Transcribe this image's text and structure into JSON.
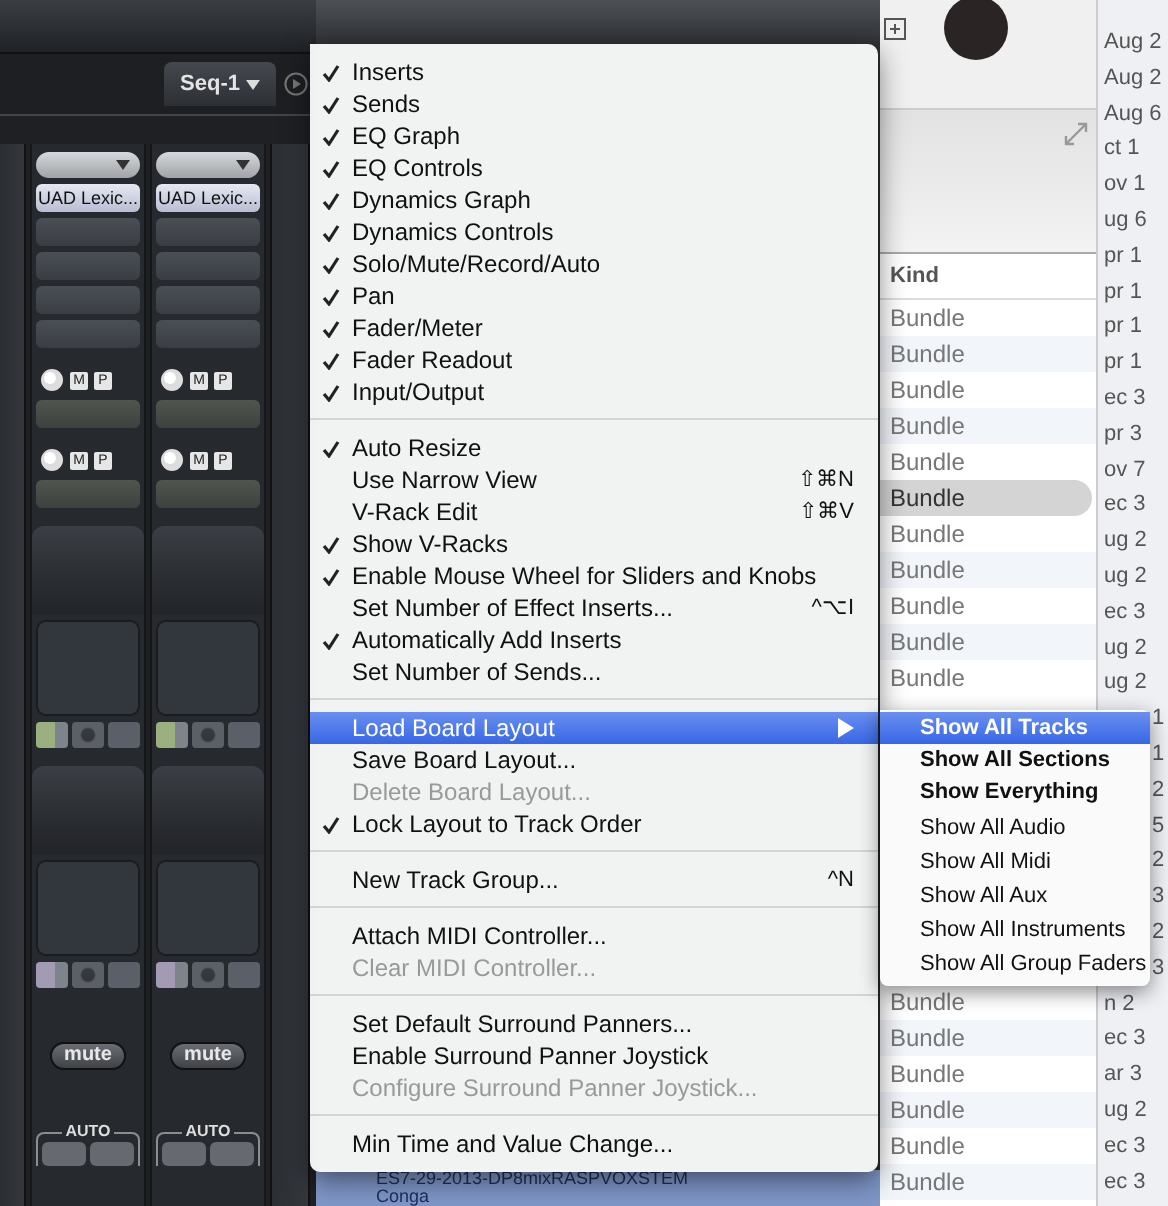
{
  "mixer": {
    "sequence": "Seq-1",
    "strips": [
      {
        "insert": "UAD Lexic...",
        "sends": [
          [
            "M",
            "P"
          ],
          [
            "M",
            "P"
          ]
        ],
        "mute": "mute",
        "auto": "AUTO"
      },
      {
        "insert": "UAD Lexic...",
        "sends": [
          [
            "M",
            "P"
          ],
          [
            "M",
            "P"
          ]
        ],
        "mute": "mute",
        "auto": "AUTO"
      }
    ]
  },
  "menu": {
    "items": [
      {
        "kind": "item",
        "label": "Inserts",
        "checked": true,
        "disabled": false,
        "selected": false
      },
      {
        "kind": "item",
        "label": "Sends",
        "checked": true,
        "disabled": false,
        "selected": false
      },
      {
        "kind": "item",
        "label": "EQ Graph",
        "checked": true,
        "disabled": false,
        "selected": false
      },
      {
        "kind": "item",
        "label": "EQ Controls",
        "checked": true,
        "disabled": false,
        "selected": false
      },
      {
        "kind": "item",
        "label": "Dynamics Graph",
        "checked": true,
        "disabled": false,
        "selected": false
      },
      {
        "kind": "item",
        "label": "Dynamics Controls",
        "checked": true,
        "disabled": false,
        "selected": false
      },
      {
        "kind": "item",
        "label": "Solo/Mute/Record/Auto",
        "checked": true,
        "disabled": false,
        "selected": false
      },
      {
        "kind": "item",
        "label": "Pan",
        "checked": true,
        "disabled": false,
        "selected": false
      },
      {
        "kind": "item",
        "label": "Fader/Meter",
        "checked": true,
        "disabled": false,
        "selected": false
      },
      {
        "kind": "item",
        "label": "Fader Readout",
        "checked": true,
        "disabled": false,
        "selected": false
      },
      {
        "kind": "item",
        "label": "Input/Output",
        "checked": true,
        "disabled": false,
        "selected": false
      },
      {
        "kind": "separator"
      },
      {
        "kind": "item",
        "label": "Auto Resize",
        "checked": true,
        "disabled": false,
        "selected": false
      },
      {
        "kind": "item",
        "label": "Use Narrow View",
        "shortcut": "⇧⌘N",
        "checked": false,
        "disabled": false,
        "selected": false
      },
      {
        "kind": "item",
        "label": "V-Rack Edit",
        "shortcut": "⇧⌘V",
        "checked": false,
        "disabled": false,
        "selected": false
      },
      {
        "kind": "item",
        "label": "Show V-Racks",
        "checked": true,
        "disabled": false,
        "selected": false
      },
      {
        "kind": "item",
        "label": "Enable Mouse Wheel for Sliders and Knobs",
        "checked": true,
        "disabled": false,
        "selected": false
      },
      {
        "kind": "item",
        "label": "Set Number of Effect Inserts...",
        "shortcut": "^⌥I",
        "checked": false,
        "disabled": false,
        "selected": false
      },
      {
        "kind": "item",
        "label": "Automatically Add Inserts",
        "checked": true,
        "disabled": false,
        "selected": false
      },
      {
        "kind": "item",
        "label": "Set Number of Sends...",
        "checked": false,
        "disabled": false,
        "selected": false
      },
      {
        "kind": "separator"
      },
      {
        "kind": "item",
        "label": "Load Board Layout",
        "submenu": true,
        "checked": false,
        "disabled": false,
        "selected": true
      },
      {
        "kind": "item",
        "label": "Save Board Layout...",
        "checked": false,
        "disabled": false,
        "selected": false
      },
      {
        "kind": "item",
        "label": "Delete Board Layout...",
        "checked": false,
        "disabled": true,
        "selected": false
      },
      {
        "kind": "item",
        "label": "Lock Layout to Track Order",
        "checked": true,
        "disabled": false,
        "selected": false
      },
      {
        "kind": "separator"
      },
      {
        "kind": "item",
        "label": "New Track Group...",
        "shortcut": "^N",
        "checked": false,
        "disabled": false,
        "selected": false
      },
      {
        "kind": "separator"
      },
      {
        "kind": "item",
        "label": "Attach MIDI Controller...",
        "checked": false,
        "disabled": false,
        "selected": false
      },
      {
        "kind": "item",
        "label": "Clear MIDI Controller...",
        "checked": false,
        "disabled": true,
        "selected": false
      },
      {
        "kind": "separator"
      },
      {
        "kind": "item",
        "label": "Set Default Surround Panners...",
        "checked": false,
        "disabled": false,
        "selected": false
      },
      {
        "kind": "item",
        "label": "Enable Surround Panner Joystick",
        "checked": false,
        "disabled": false,
        "selected": false
      },
      {
        "kind": "item",
        "label": "Configure Surround Panner Joystick...",
        "checked": false,
        "disabled": true,
        "selected": false
      },
      {
        "kind": "separator"
      },
      {
        "kind": "item",
        "label": "Min Time and Value Change...",
        "checked": false,
        "disabled": false,
        "selected": false
      }
    ]
  },
  "submenu": {
    "groups": [
      {
        "emphasized": true,
        "items": [
          {
            "label": "Show All Tracks",
            "selected": true
          },
          {
            "label": "Show All Sections",
            "selected": false
          },
          {
            "label": "Show Everything",
            "selected": false
          }
        ]
      },
      {
        "emphasized": false,
        "items": [
          {
            "label": "Show All Audio",
            "selected": false
          },
          {
            "label": "Show All Midi",
            "selected": false
          },
          {
            "label": "Show All Aux",
            "selected": false
          },
          {
            "label": "Show All Instruments",
            "selected": false
          },
          {
            "label": "Show All Group Faders",
            "selected": false
          }
        ]
      }
    ]
  },
  "kind_list": {
    "header": "Kind",
    "rows": [
      {
        "label": "Bundle",
        "selected": false
      },
      {
        "label": "Bundle",
        "selected": false
      },
      {
        "label": "Bundle",
        "selected": false
      },
      {
        "label": "Bundle",
        "selected": false
      },
      {
        "label": "Bundle",
        "selected": false
      },
      {
        "label": "Bundle",
        "selected": true
      },
      {
        "label": "Bundle",
        "selected": false
      },
      {
        "label": "Bundle",
        "selected": false
      },
      {
        "label": "Bundle",
        "selected": false
      },
      {
        "label": "Bundle",
        "selected": false
      },
      {
        "label": "Bundle",
        "selected": false
      }
    ],
    "rows_lower": [
      {
        "label": "Bundle",
        "selected": false
      },
      {
        "label": "Bundle",
        "selected": false
      },
      {
        "label": "Bundle",
        "selected": false
      },
      {
        "label": "Bundle",
        "selected": false
      },
      {
        "label": "Bundle",
        "selected": false
      },
      {
        "label": "Bundle",
        "selected": false
      }
    ]
  },
  "date_column": {
    "rows": [
      {
        "text": "Aug 2",
        "kind": "full"
      },
      {
        "text": "Aug 2",
        "kind": "full"
      },
      {
        "text": "Aug 6",
        "kind": "full"
      },
      {
        "text": "ct 1",
        "kind": "full"
      },
      {
        "text": "ov 1",
        "kind": "full"
      },
      {
        "text": "ug 6",
        "kind": "full"
      },
      {
        "text": "pr 1",
        "kind": "full"
      },
      {
        "text": "pr 1",
        "kind": "full"
      },
      {
        "text": "pr 1",
        "kind": "full"
      },
      {
        "text": "pr 1",
        "kind": "full"
      },
      {
        "text": "ec 3",
        "kind": "full"
      },
      {
        "text": "pr 3",
        "kind": "full"
      },
      {
        "text": "ov 7",
        "kind": "full"
      },
      {
        "text": "ec 3",
        "kind": "full"
      },
      {
        "text": "ug 2",
        "kind": "full"
      },
      {
        "text": "ug 2",
        "kind": "full"
      },
      {
        "text": "ec 3",
        "kind": "full"
      },
      {
        "text": "ug 2",
        "kind": "full"
      },
      {
        "text": "ug 2",
        "kind": "full"
      },
      {
        "text": "1",
        "kind": "clipped"
      },
      {
        "text": "1",
        "kind": "clipped"
      },
      {
        "text": "2",
        "kind": "clipped"
      },
      {
        "text": "5",
        "kind": "clipped"
      },
      {
        "text": "2",
        "kind": "clipped"
      },
      {
        "text": "3",
        "kind": "clipped"
      },
      {
        "text": "2",
        "kind": "clipped"
      },
      {
        "text": "3",
        "kind": "clipped"
      },
      {
        "text": "n 2",
        "kind": "full"
      },
      {
        "text": "ec 3",
        "kind": "full"
      },
      {
        "text": "ar 3",
        "kind": "full"
      },
      {
        "text": "ug 2",
        "kind": "full"
      },
      {
        "text": "ec 3",
        "kind": "full"
      },
      {
        "text": "ec 3",
        "kind": "full"
      }
    ]
  },
  "track_list": {
    "rows": [
      "ES7-29-2013-DP8mixRASPVOXSTEM",
      "Conga"
    ]
  }
}
